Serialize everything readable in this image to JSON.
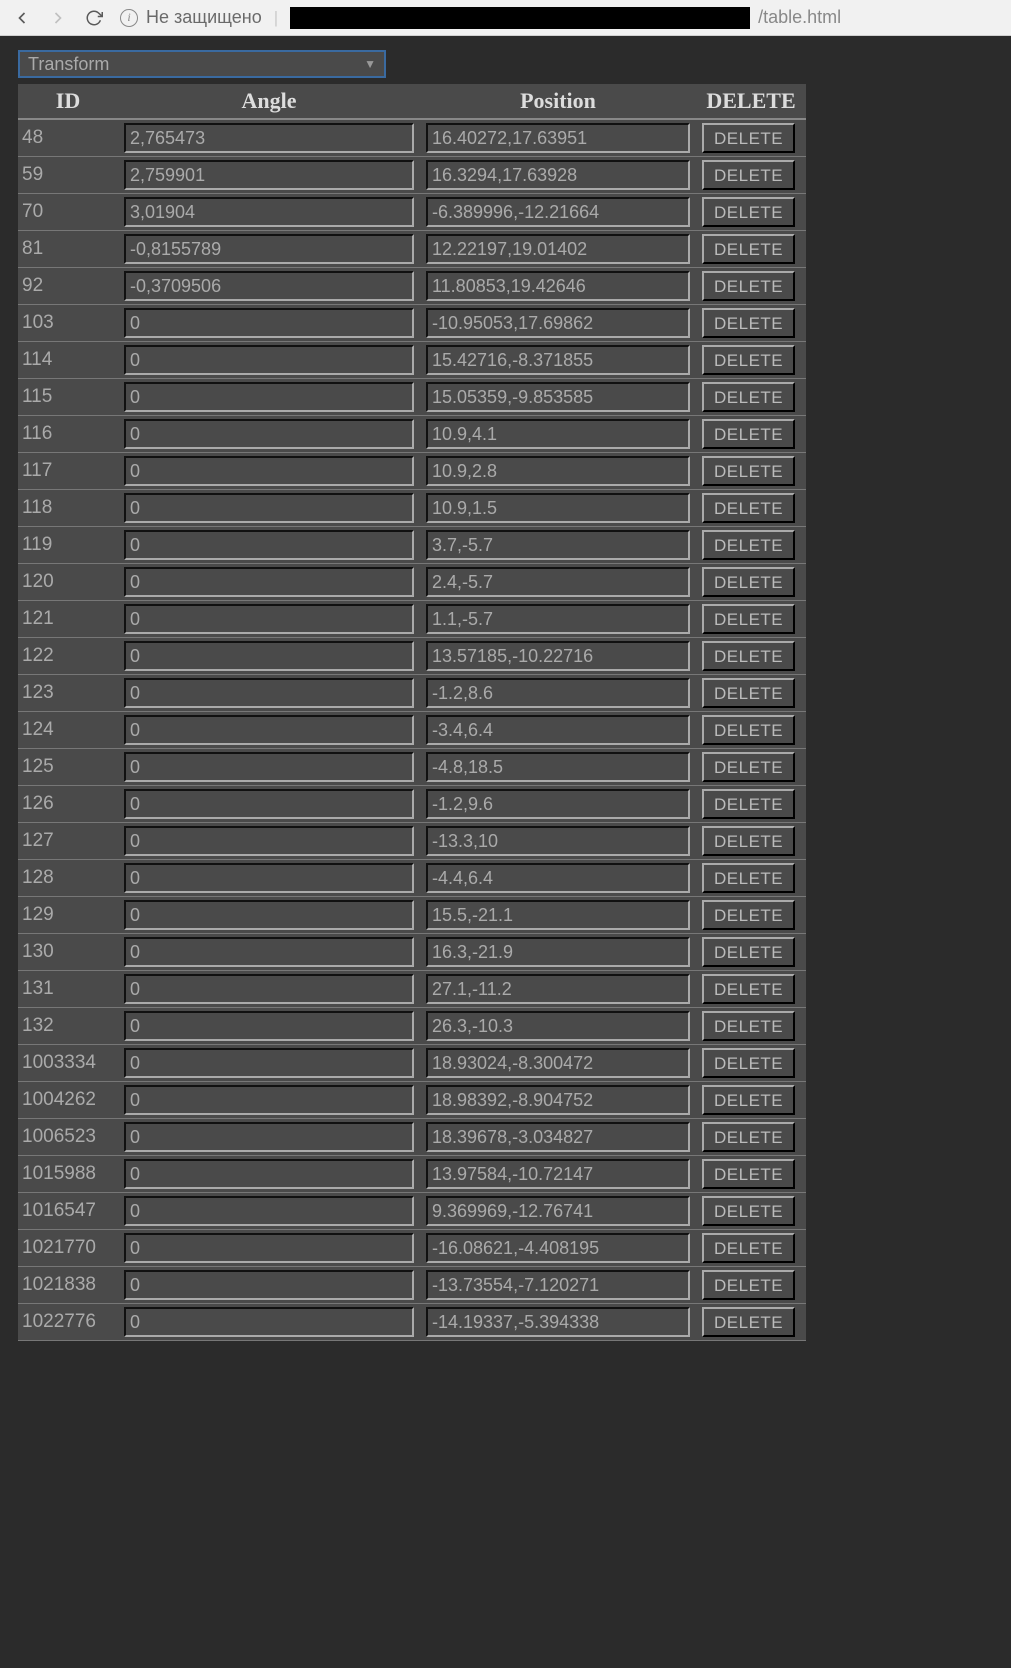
{
  "browser": {
    "security_label": "Не защищено",
    "url_path": "/table.html"
  },
  "dropdown": {
    "selected": "Transform"
  },
  "table": {
    "headers": {
      "id": "ID",
      "angle": "Angle",
      "position": "Position",
      "delete": "DELETE"
    },
    "delete_label": "DELETE",
    "rows": [
      {
        "id": "48",
        "angle": "2,765473",
        "position": "16.40272,17.63951"
      },
      {
        "id": "59",
        "angle": "2,759901",
        "position": "16.3294,17.63928"
      },
      {
        "id": "70",
        "angle": "3,01904",
        "position": "-6.389996,-12.21664"
      },
      {
        "id": "81",
        "angle": "-0,8155789",
        "position": "12.22197,19.01402"
      },
      {
        "id": "92",
        "angle": "-0,3709506",
        "position": "11.80853,19.42646"
      },
      {
        "id": "103",
        "angle": "0",
        "position": "-10.95053,17.69862"
      },
      {
        "id": "114",
        "angle": "0",
        "position": "15.42716,-8.371855"
      },
      {
        "id": "115",
        "angle": "0",
        "position": "15.05359,-9.853585"
      },
      {
        "id": "116",
        "angle": "0",
        "position": "10.9,4.1"
      },
      {
        "id": "117",
        "angle": "0",
        "position": "10.9,2.8"
      },
      {
        "id": "118",
        "angle": "0",
        "position": "10.9,1.5"
      },
      {
        "id": "119",
        "angle": "0",
        "position": "3.7,-5.7"
      },
      {
        "id": "120",
        "angle": "0",
        "position": "2.4,-5.7"
      },
      {
        "id": "121",
        "angle": "0",
        "position": "1.1,-5.7"
      },
      {
        "id": "122",
        "angle": "0",
        "position": "13.57185,-10.22716"
      },
      {
        "id": "123",
        "angle": "0",
        "position": "-1.2,8.6"
      },
      {
        "id": "124",
        "angle": "0",
        "position": "-3.4,6.4"
      },
      {
        "id": "125",
        "angle": "0",
        "position": "-4.8,18.5"
      },
      {
        "id": "126",
        "angle": "0",
        "position": "-1.2,9.6"
      },
      {
        "id": "127",
        "angle": "0",
        "position": "-13.3,10"
      },
      {
        "id": "128",
        "angle": "0",
        "position": "-4.4,6.4"
      },
      {
        "id": "129",
        "angle": "0",
        "position": "15.5,-21.1"
      },
      {
        "id": "130",
        "angle": "0",
        "position": "16.3,-21.9"
      },
      {
        "id": "131",
        "angle": "0",
        "position": "27.1,-11.2"
      },
      {
        "id": "132",
        "angle": "0",
        "position": "26.3,-10.3"
      },
      {
        "id": "1003334",
        "angle": "0",
        "position": "18.93024,-8.300472"
      },
      {
        "id": "1004262",
        "angle": "0",
        "position": "18.98392,-8.904752"
      },
      {
        "id": "1006523",
        "angle": "0",
        "position": "18.39678,-3.034827"
      },
      {
        "id": "1015988",
        "angle": "0",
        "position": "13.97584,-10.72147"
      },
      {
        "id": "1016547",
        "angle": "0",
        "position": "9.369969,-12.76741"
      },
      {
        "id": "1021770",
        "angle": "0",
        "position": "-16.08621,-4.408195"
      },
      {
        "id": "1021838",
        "angle": "0",
        "position": "-13.73554,-7.120271"
      },
      {
        "id": "1022776",
        "angle": "0",
        "position": "-14.19337,-5.394338"
      }
    ]
  }
}
